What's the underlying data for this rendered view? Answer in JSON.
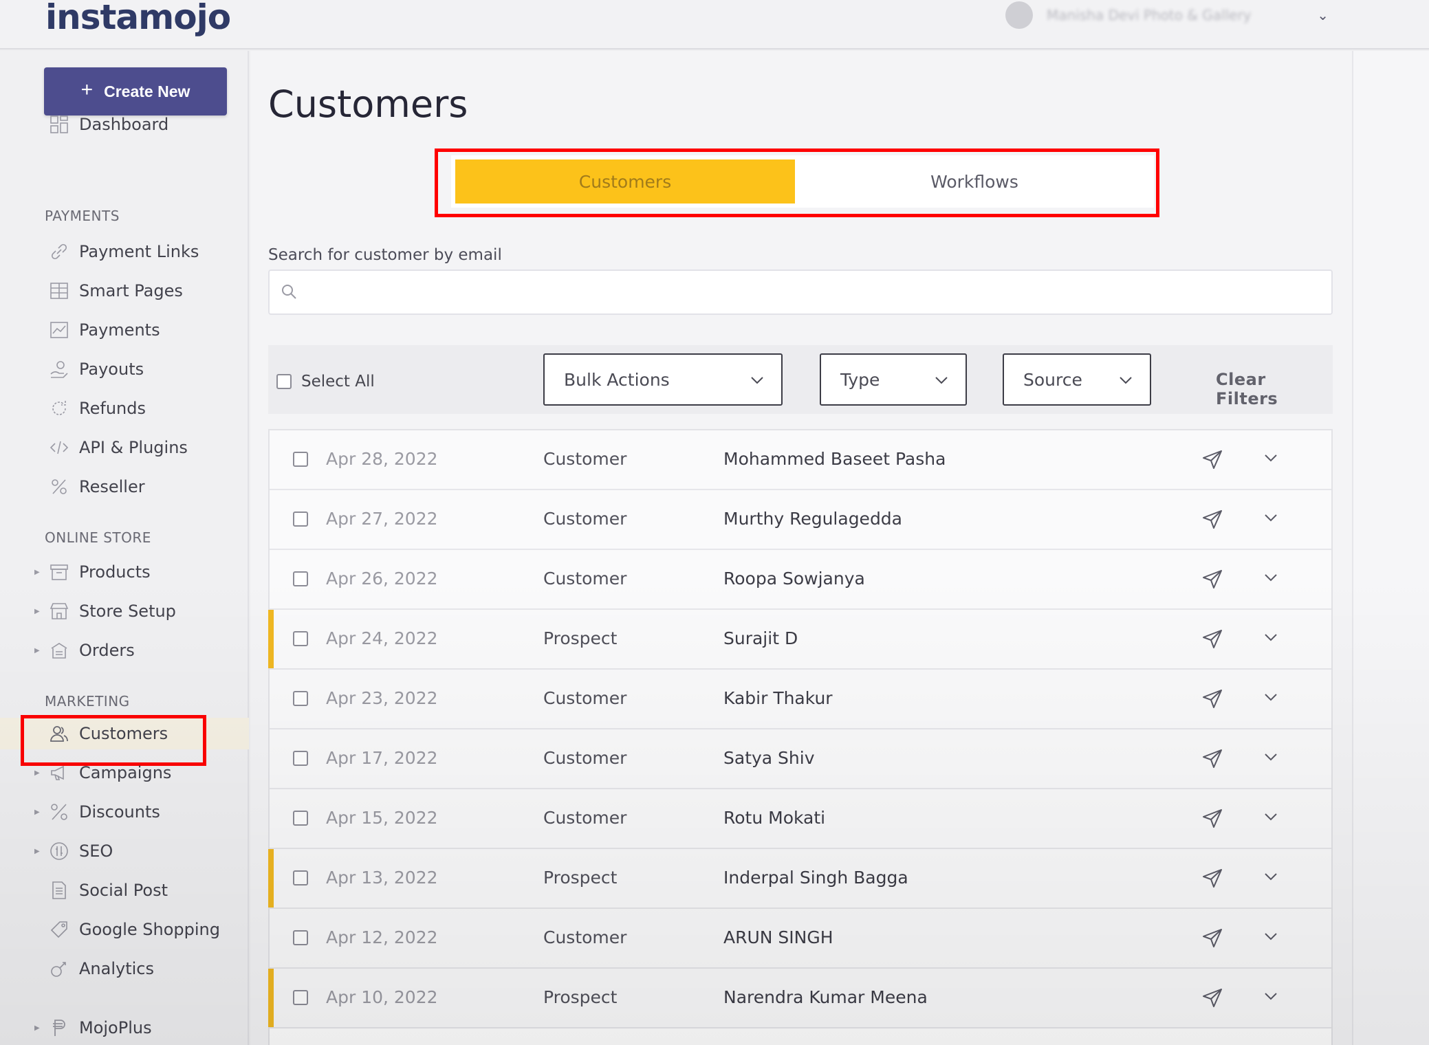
{
  "brand": {
    "logo_text": "instamojo"
  },
  "account": {
    "name": "Manisha Devi Photo & Gallery"
  },
  "sidebar": {
    "create_new": "Create New",
    "dashboard": "Dashboard",
    "sections": {
      "payments": "PAYMENTS",
      "online_store": "ONLINE STORE",
      "marketing": "MARKETING"
    },
    "payments_items": [
      "Payment Links",
      "Smart Pages",
      "Payments",
      "Payouts",
      "Refunds",
      "API & Plugins",
      "Reseller"
    ],
    "store_items": [
      "Products",
      "Store Setup",
      "Orders"
    ],
    "marketing_items": [
      "Customers",
      "Campaigns",
      "Discounts",
      "SEO",
      "Social Post",
      "Google Shopping",
      "Analytics"
    ],
    "mojoplus": "MojoPlus",
    "active_item": "Customers"
  },
  "main": {
    "title": "Customers",
    "tabs": [
      "Customers",
      "Workflows"
    ],
    "active_tab": "Customers",
    "search": {
      "label": "Search for customer by email",
      "value": "",
      "placeholder": ""
    },
    "filters": {
      "select_all": "Select All",
      "bulk_actions": "Bulk Actions",
      "type": "Type",
      "source": "Source",
      "clear_filters": "Clear Filters"
    },
    "rows": [
      {
        "date": "Apr 28, 2022",
        "type": "Customer",
        "name": "Mohammed Baseet Pasha"
      },
      {
        "date": "Apr 27, 2022",
        "type": "Customer",
        "name": "Murthy Regulagedda"
      },
      {
        "date": "Apr 26, 2022",
        "type": "Customer",
        "name": "Roopa Sowjanya"
      },
      {
        "date": "Apr 24, 2022",
        "type": "Prospect",
        "name": "Surajit D"
      },
      {
        "date": "Apr 23, 2022",
        "type": "Customer",
        "name": "Kabir Thakur"
      },
      {
        "date": "Apr 17, 2022",
        "type": "Customer",
        "name": "Satya Shiv"
      },
      {
        "date": "Apr 15, 2022",
        "type": "Customer",
        "name": "Rotu Mokati"
      },
      {
        "date": "Apr 13, 2022",
        "type": "Prospect",
        "name": "Inderpal Singh Bagga"
      },
      {
        "date": "Apr 12, 2022",
        "type": "Customer",
        "name": "ARUN SINGH"
      },
      {
        "date": "Apr 10, 2022",
        "type": "Prospect",
        "name": "Narendra Kumar Meena"
      }
    ]
  },
  "colors": {
    "primary_button": "#4d4d8e",
    "active_tab": "#fcc21a",
    "prospect_marker": "#f0b822",
    "highlight_box": "#ff0000"
  }
}
